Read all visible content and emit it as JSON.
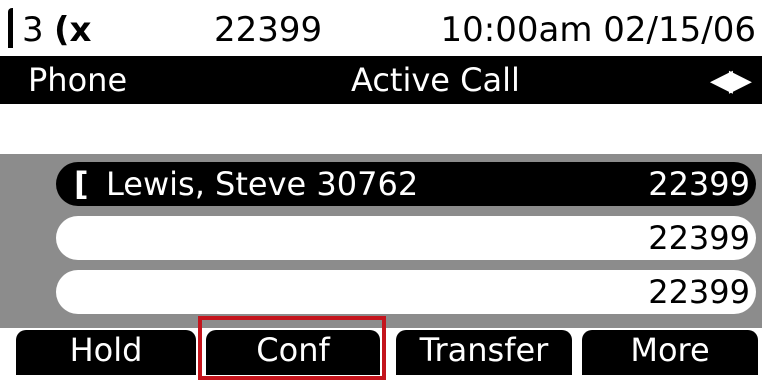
{
  "status_bar": {
    "line_number": "3",
    "line_icon": "(x",
    "extension": "22399",
    "datetime": "10:00am 02/15/06"
  },
  "title_bar": {
    "app": "Phone",
    "screen": "Active Call",
    "nav_icon": "left-right-arrows-icon"
  },
  "calls": [
    {
      "icon": "[",
      "name": "Lewis, Steve 30762",
      "line": "22399",
      "state": "active"
    },
    {
      "icon": "",
      "name": "",
      "line": "22399",
      "state": "idle"
    },
    {
      "icon": "",
      "name": "",
      "line": "22399",
      "state": "idle"
    }
  ],
  "softkeys": {
    "hold": "Hold",
    "conf": "Conf",
    "transfer": "Transfer",
    "more": "More"
  },
  "colors": {
    "accent_highlight": "#c4141c",
    "call_area_bg": "#8c8c8c",
    "bar_bg": "#000000"
  }
}
